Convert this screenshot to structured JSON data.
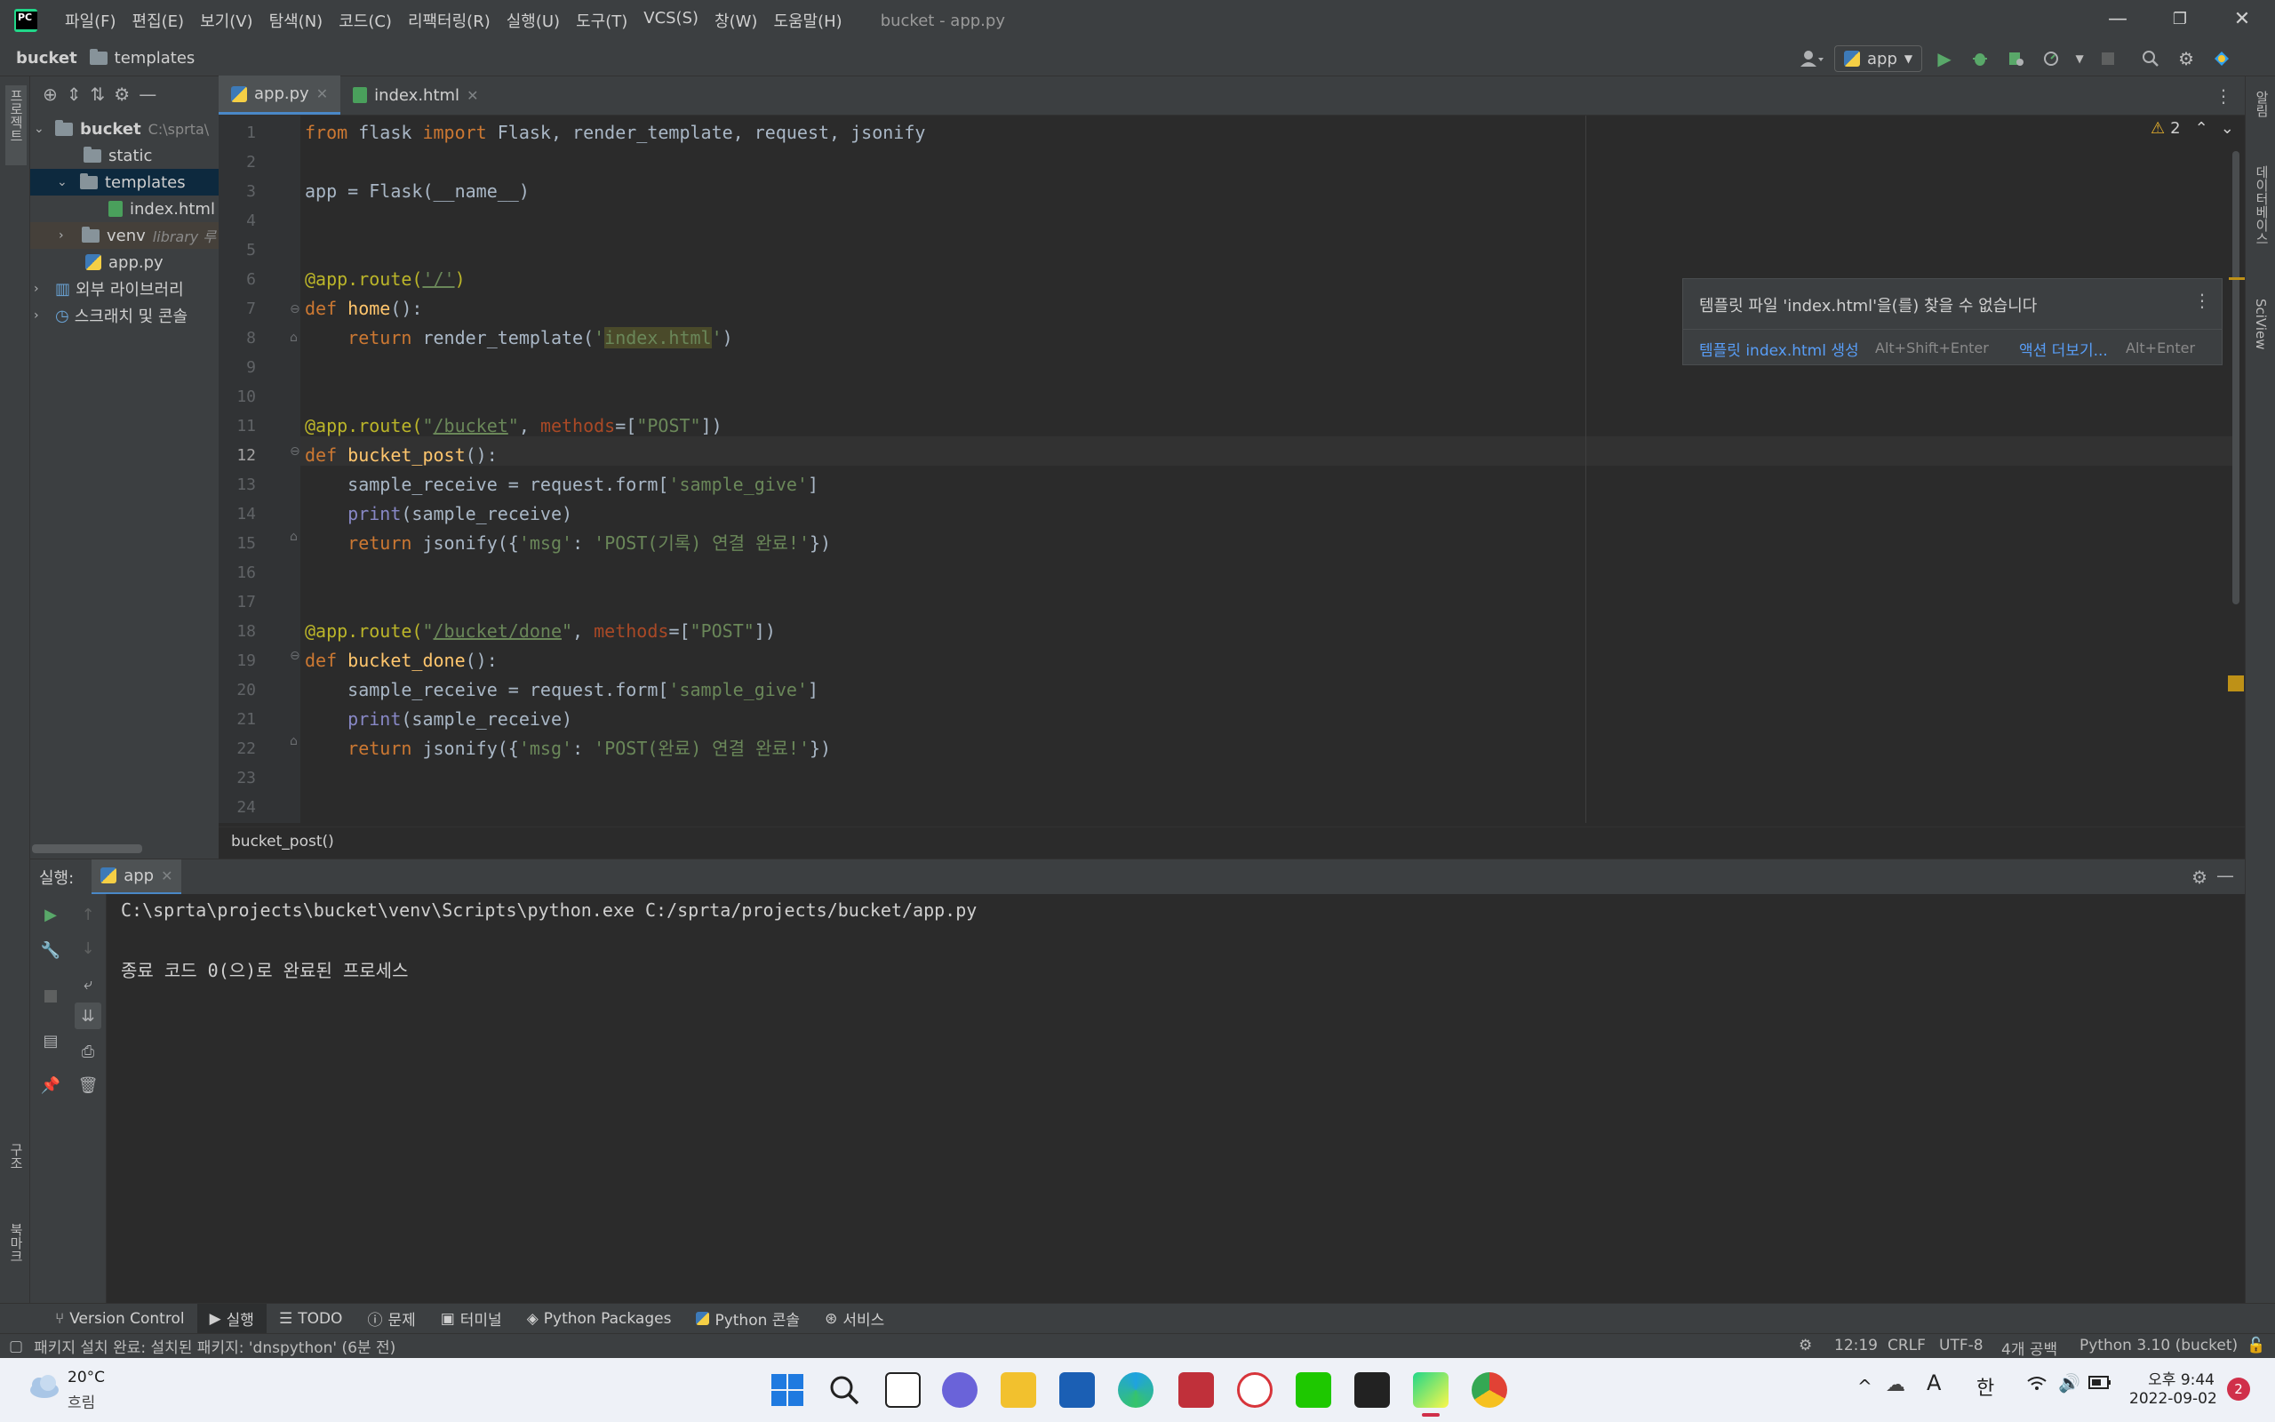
{
  "window": {
    "title": "bucket - app.py",
    "menu": [
      "파일(F)",
      "편집(E)",
      "보기(V)",
      "탐색(N)",
      "코드(C)",
      "리팩터링(R)",
      "실행(U)",
      "도구(T)",
      "VCS(S)",
      "창(W)",
      "도움말(H)"
    ],
    "minimize_icon": "—",
    "restore_icon": "❐",
    "close_icon": "✕"
  },
  "navbar": {
    "crumb_project": "bucket",
    "crumb_folder": "templates",
    "run_config": "app"
  },
  "left_strip": {
    "project_label": "프로젝트",
    "structure_label": "구조",
    "bookmarks_label": "북마크"
  },
  "right_strip": {
    "notifications_label": "알림",
    "database_label": "데이터베이스",
    "sciview_label": "SciView"
  },
  "project_tree": {
    "root": "bucket",
    "root_path": "C:\\sprta\\",
    "static": "static",
    "templates": "templates",
    "index_html": "index.html",
    "venv": "venv",
    "venv_note": "library 루",
    "app_py": "app.py",
    "external_libs": "외부 라이브러리",
    "scratches": "스크래치 및 콘솔"
  },
  "editor": {
    "tabs": [
      {
        "label": "app.py",
        "active": true
      },
      {
        "label": "index.html",
        "active": false
      }
    ],
    "current_line": 12,
    "warning_count": "2",
    "line_numbers": [
      "1",
      "2",
      "3",
      "4",
      "5",
      "6",
      "7",
      "8",
      "9",
      "10",
      "11",
      "12",
      "13",
      "14",
      "15",
      "16",
      "17",
      "18",
      "19",
      "20",
      "21",
      "22",
      "23",
      "24"
    ],
    "code": {
      "l1_from": "from",
      "l1_mod": " flask ",
      "l1_import": "import",
      "l1_rest": " Flask, render_template, request, jsonify",
      "l3": "app = Flask(__name__)",
      "l6_deco": "@app.route(",
      "l6_str": "'/'",
      "l6_close": ")",
      "l7_def": "def",
      "l7_fn": " home",
      "l7_rest": "():",
      "l8_ret": "return",
      "l8_mid": " render_template(",
      "l8_q1": "'",
      "l8_hl": "index.html",
      "l8_q2": "'",
      "l8_end": ")",
      "l11_deco": "@app.route(",
      "l11_q1": "\"",
      "l11_path": "/bucket",
      "l11_q2": "\"",
      "l11_comma": ", ",
      "l11_param": "methods",
      "l11_eq": "=[",
      "l11_post": "\"POST\"",
      "l11_end": "])",
      "l12_def": "def",
      "l12_fn": " bucket_post",
      "l12_rest": "():",
      "l13_a": "sample_receive = request.form[",
      "l13_s": "'sample_give'",
      "l13_b": "]",
      "l14_print": "print",
      "l14_rest": "(sample_receive)",
      "l15_ret": "return",
      "l15_a": " jsonify({",
      "l15_k": "'msg'",
      "l15_c": ": ",
      "l15_v": "'POST(기록) 연결 완료!'",
      "l15_end": "})",
      "l18_deco": "@app.route(",
      "l18_q1": "\"",
      "l18_path": "/bucket/done",
      "l18_q2": "\"",
      "l18_comma": ", ",
      "l18_param": "methods",
      "l18_eq": "=[",
      "l18_post": "\"POST\"",
      "l18_end": "])",
      "l19_def": "def",
      "l19_fn": " bucket_done",
      "l19_rest": "():",
      "l20_a": "sample_receive = request.form[",
      "l20_s": "'sample_give'",
      "l20_b": "]",
      "l21_print": "print",
      "l21_rest": "(sample_receive)",
      "l22_ret": "return",
      "l22_a": " jsonify({",
      "l22_k": "'msg'",
      "l22_c": ": ",
      "l22_v": "'POST(완료) 연결 완료!'",
      "l22_end": "})"
    },
    "breadcrumb": "bucket_post()"
  },
  "popup": {
    "message": "템플릿 파일 'index.html'을(를) 찾을 수 없습니다",
    "action1": "템플릿 index.html 생성",
    "action1_shortcut": "Alt+Shift+Enter",
    "action2": "액션 더보기...",
    "action2_shortcut": "Alt+Enter"
  },
  "run": {
    "label": "실행:",
    "tab": "app",
    "command": "C:\\sprta\\projects\\bucket\\venv\\Scripts\\python.exe C:/sprta/projects/bucket/app.py",
    "exit_message": "종료 코드 0(으)로 완료된 프로세스"
  },
  "bottom_tabs": [
    "Version Control",
    "실행",
    "TODO",
    "문제",
    "터미널",
    "Python Packages",
    "Python 콘솔",
    "서비스"
  ],
  "status": {
    "message": "패키지 설치 완료: 설치된 패키지: 'dnspython' (6분 전)",
    "position": "12:19",
    "line_sep": "CRLF",
    "encoding": "UTF-8",
    "indent": "4개 공백",
    "interpreter": "Python 3.10 (bucket)"
  },
  "taskbar": {
    "temperature": "20°C",
    "weather": "흐림",
    "ime": "한",
    "font_icon": "A",
    "time": "오후 9:44",
    "date": "2022-09-02",
    "notification_count": "2"
  },
  "colors": {
    "accent": "#4a88c7",
    "keyword": "#cc7832",
    "string": "#6a8759",
    "function": "#ffc66d",
    "decorator": "#bbb529"
  }
}
